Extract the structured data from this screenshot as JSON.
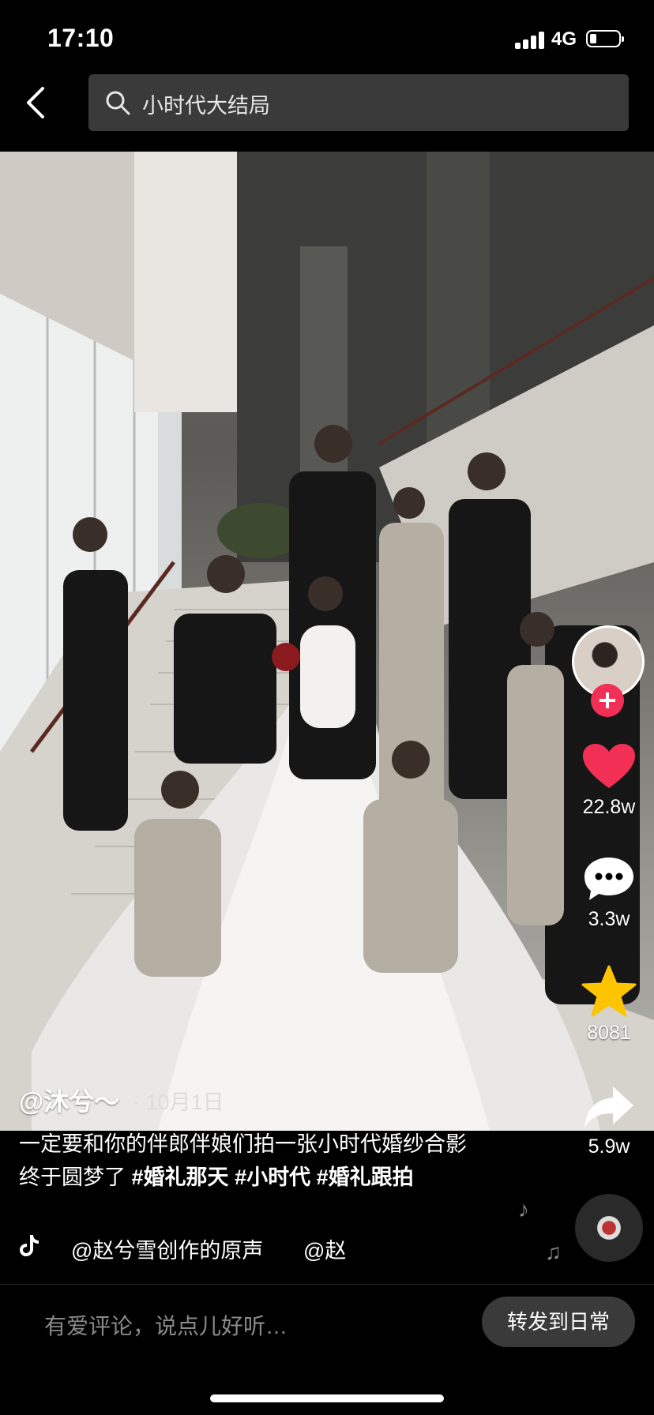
{
  "status_bar": {
    "time": "17:10",
    "network": "4G"
  },
  "search": {
    "query": "小时代大结局"
  },
  "post": {
    "author": "@沐兮～",
    "date": "· 10月1日",
    "caption_text": "一定要和你的伴郎伴娘们拍一张小时代婚纱合影 终于圆梦了 ",
    "hashtags": [
      "#婚礼那天",
      "#小时代",
      "#婚礼跟拍"
    ],
    "music": "@赵兮雪创作的原声",
    "music_scroll": "@赵"
  },
  "actions": {
    "likes": "22.8w",
    "comments": "3.3w",
    "favorites": "8081",
    "shares": "5.9w"
  },
  "bottom_bar": {
    "comment_placeholder": "有爱评论，说点儿好听…",
    "share_daily_label": "转发到日常"
  },
  "colors": {
    "accent_red": "#f22f55",
    "star_yellow": "#ffc400",
    "background": "#000000"
  }
}
